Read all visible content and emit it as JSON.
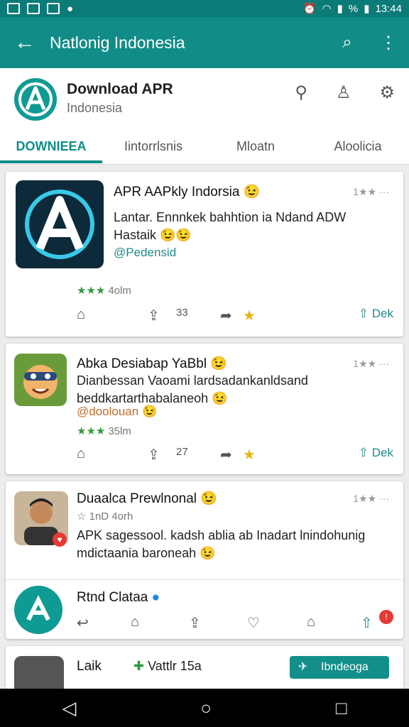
{
  "status": {
    "battery": "%",
    "time": "13:44"
  },
  "appbar": {
    "title": "Natlonig Indonesia"
  },
  "header": {
    "title": "Download APR",
    "subtitle": "Indonesia"
  },
  "tabs": [
    {
      "label": "DOWNIEEA"
    },
    {
      "label": "Iintorrlsnis"
    },
    {
      "label": "Mloatn"
    },
    {
      "label": "Aloolicia"
    }
  ],
  "cards": [
    {
      "name": "APR AAPkly Indorsia 😉",
      "rating": "1★★ ···",
      "body": "Lantar. Ennnkek bahhtion ia Ndand ADW Hastaik 😉😉",
      "tag": "@Pedensid",
      "stars_count": "4olm",
      "count": "33",
      "download_label": "Dek"
    },
    {
      "name": "Abka Desiabap YaBbl 😉",
      "rating": "1★★ ···",
      "body": "Dianbessan Vaoami lardsadankanldsand beddkartarthabalaneoh 😉",
      "tag": "@doolouan 😉",
      "stars_count": "35lm",
      "count": "27",
      "download_label": "Dek"
    },
    {
      "name": "Duaalca Prewlnonal 😉",
      "rating": "1★★ ···",
      "sub": "☆ 1nD 4orh",
      "body": "APK sagessool. kadsh ablia ab Inadart lnindohunig mdictaania baroneah 😉"
    }
  ],
  "inner": {
    "name": "Rtnd Clataa"
  },
  "last": {
    "name": "Laik",
    "verified": "Vattlr 15a",
    "button": "Ibndeoga"
  }
}
